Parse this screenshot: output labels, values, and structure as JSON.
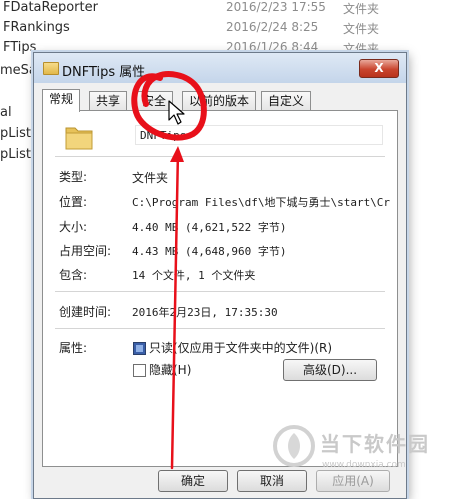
{
  "background": {
    "rows": [
      {
        "name": "FDataReporter",
        "date": "2016/2/23 17:55",
        "type": "文件夹"
      },
      {
        "name": "FRankings",
        "date": "2016/2/24 8:25",
        "type": "文件夹"
      },
      {
        "name": "FTips",
        "date": "2016/1/26 8:44",
        "type": "文件夹"
      }
    ],
    "side_fragments": [
      "meSa",
      "al",
      "pList.",
      "pList."
    ]
  },
  "dialog": {
    "title": "DNFTips 属性",
    "close_label": "X",
    "tabs": [
      "常规",
      "共享",
      "安全",
      "以前的版本",
      "自定义"
    ],
    "active_tab": "常规",
    "folder_name": "DNFTips",
    "properties": [
      {
        "label": "类型:",
        "value": "文件夹"
      },
      {
        "label": "位置:",
        "value": "C:\\Program Files\\df\\地下城与勇士\\start\\Cr"
      },
      {
        "label": "大小:",
        "value": "4.40 MB (4,621,522 字节)"
      },
      {
        "label": "占用空间:",
        "value": "4.43 MB (4,648,960 字节)"
      },
      {
        "label": "包含:",
        "value": "14 个文件, 1 个文件夹"
      }
    ],
    "created_label": "创建时间:",
    "created_value": "2016年2月23日, 17:35:30",
    "attributes_label": "属性:",
    "readonly_label": "只读(仅应用于文件夹中的文件)(R)",
    "hidden_label": "隐藏(H)",
    "advanced_label": "高级(D)...",
    "ok_label": "确定",
    "cancel_label": "取消",
    "apply_label": "应用(A)"
  },
  "watermark": {
    "brand": "当下软件园",
    "url": "www.downxia.com"
  },
  "colors": {
    "annotation": "#e8101a",
    "titlebar": "#c4d5ea",
    "close": "#c9452e"
  }
}
